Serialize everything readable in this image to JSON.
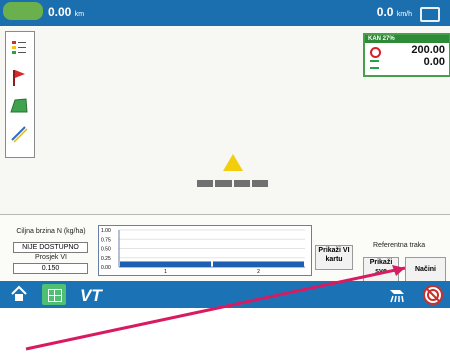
{
  "topbar": {
    "speed_left": "0.00",
    "speed_left_unit": "km",
    "speed_right": "0.0",
    "speed_right_unit": "km/h"
  },
  "rate_panel": {
    "product_label": "KAN 27%",
    "target_rate": "200.00",
    "actual_rate": "0.00"
  },
  "bottom": {
    "target_title": "Ciljna brzina N (kg/ha)",
    "target_value": "NIJE DOSTUPNO",
    "avg_title": "Prosjek VI",
    "avg_value": "0.150",
    "show_vi_map_button": "Prikaži VI kartu",
    "reference_title": "Referentna traka",
    "show_all_button": "Prikaži sve",
    "modes_button": "Načini"
  },
  "chart_data": {
    "type": "bar",
    "title": "",
    "xlabel": "",
    "ylabel": "",
    "y_ticks": [
      "1.00",
      "0.75",
      "0.50",
      "0.25",
      "0.00"
    ],
    "x_ticks": [
      "1",
      "2"
    ],
    "ylim": [
      0,
      1
    ],
    "values": [
      0.15,
      0.15
    ]
  },
  "icons": {
    "home": "home-icon",
    "grid": "grid-icon",
    "vt": "VT",
    "spray": "sprayer-icon",
    "stop": "steering-stop-icon"
  },
  "colors": {
    "topbar": "#1c6fae",
    "taskbar": "#1b73b6",
    "accent_green": "#46a04a",
    "arrow_red": "#d81b60",
    "vehicle_yellow": "#f2ce0c"
  }
}
